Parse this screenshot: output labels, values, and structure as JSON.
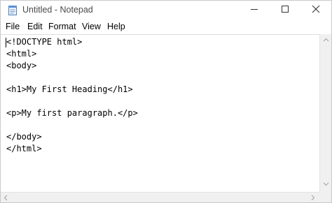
{
  "window": {
    "title": "Untitled - Notepad"
  },
  "menu": {
    "items": [
      "File",
      "Edit",
      "Format",
      "View",
      "Help"
    ]
  },
  "editor": {
    "lines": [
      "<!DOCTYPE html>",
      "<html>",
      "<body>",
      "",
      "<h1>My First Heading</h1>",
      "",
      "<p>My first paragraph.</p>",
      "",
      "</body>",
      "</html>"
    ]
  },
  "icons": {
    "app": "notepad-icon",
    "minimize": "minimize-icon",
    "maximize": "maximize-icon",
    "close": "close-icon"
  },
  "colors": {
    "title_text": "#4a4a4a",
    "scrollbar": "#f0f0f0"
  }
}
